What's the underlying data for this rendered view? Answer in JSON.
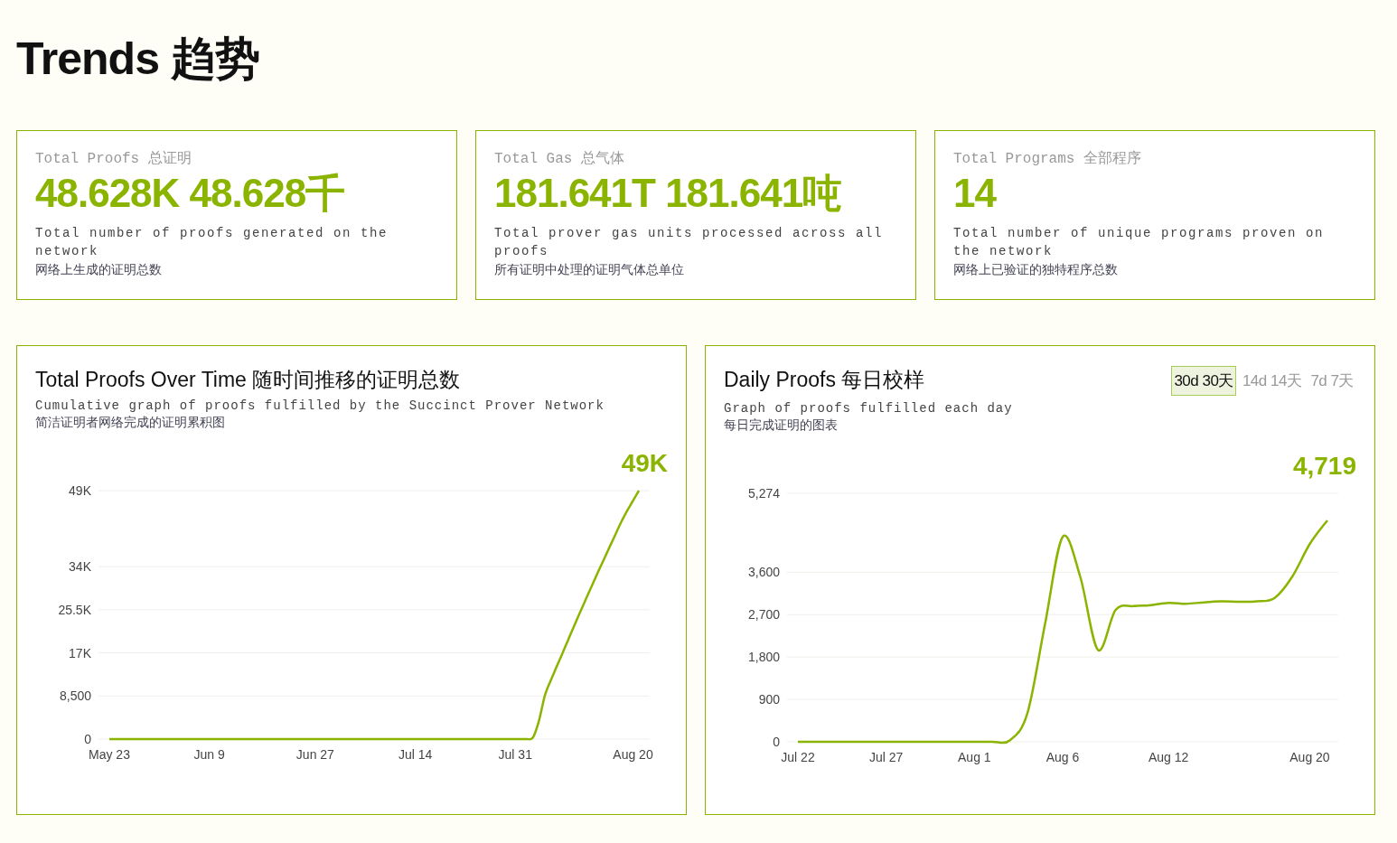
{
  "page_title": "Trends 趋势",
  "stats": [
    {
      "label": "Total Proofs 总证明",
      "value": "48.628K 48.628千",
      "description": "Total number of proofs generated on the network",
      "description_zh": "网络上生成的证明总数"
    },
    {
      "label": "Total Gas 总气体",
      "value": "181.641T 181.641吨",
      "description": "Total prover gas units processed across all proofs",
      "description_zh": "所有证明中处理的证明气体总单位"
    },
    {
      "label": "Total Programs 全部程序",
      "value": "14",
      "description": "Total number of unique programs proven on the network",
      "description_zh": "网络上已验证的独特程序总数"
    }
  ],
  "charts": [
    {
      "title": "Total Proofs Over Time  随时间推移的证明总数",
      "subtitle": "Cumulative graph of proofs fulfilled by the Succinct Prover Network",
      "subtitle_zh": "简洁证明者网络完成的证明累积图",
      "headline": "49K",
      "chart_data": {
        "type": "line",
        "grid": true,
        "categories": [
          "May 23",
          null,
          null,
          null,
          null,
          null,
          null,
          null,
          null,
          null,
          null,
          null,
          null,
          null,
          null,
          null,
          null,
          "Jun 9",
          null,
          null,
          null,
          null,
          null,
          null,
          null,
          null,
          null,
          null,
          null,
          null,
          null,
          null,
          null,
          null,
          null,
          "Jun 27",
          null,
          null,
          null,
          null,
          null,
          null,
          null,
          null,
          null,
          null,
          null,
          null,
          null,
          null,
          null,
          null,
          "Jul 14",
          null,
          null,
          null,
          null,
          null,
          null,
          null,
          null,
          null,
          null,
          null,
          null,
          null,
          null,
          null,
          null,
          "Jul 31",
          null,
          null,
          null,
          null,
          null,
          null,
          null,
          null,
          null,
          null,
          null,
          null,
          null,
          null,
          null,
          null,
          null,
          null,
          null,
          "Aug 20",
          null
        ],
        "series": [
          {
            "color": "#8ab400",
            "values": [
              0,
              0,
              0,
              0,
              0,
              0,
              0,
              0,
              0,
              0,
              0,
              0,
              0,
              0,
              0,
              0,
              0,
              0,
              0,
              0,
              0,
              0,
              0,
              0,
              0,
              0,
              0,
              0,
              0,
              0,
              0,
              0,
              0,
              0,
              0,
              0,
              0,
              0,
              0,
              0,
              0,
              0,
              0,
              0,
              0,
              0,
              0,
              0,
              0,
              0,
              0,
              0,
              0,
              0,
              0,
              0,
              0,
              0,
              0,
              0,
              0,
              0,
              0,
              0,
              0,
              0,
              0,
              0,
              0,
              0,
              0,
              0,
              300,
              3500,
              8500,
              11500,
              14200,
              16900,
              19600,
              22300,
              25000,
              27600,
              30200,
              32800,
              35300,
              37800,
              40300,
              42800,
              45000,
              47000,
              49000
            ]
          }
        ],
        "ylim": [
          0,
          49000
        ],
        "yticks": [
          0,
          {
            "value": 8500,
            "label": "8,500"
          },
          {
            "value": 17000,
            "label": "17K"
          },
          {
            "value": 25500,
            "label": "25.5K"
          },
          {
            "value": 34000,
            "label": "34K"
          },
          {
            "value": 49000,
            "label": "49K"
          }
        ]
      }
    },
    {
      "title": "Daily Proofs  每日校样",
      "subtitle": "Graph of proofs fulfilled each day",
      "subtitle_zh": "每日完成证明的图表",
      "headline": "4,719",
      "tabs": [
        {
          "label": "30d 30天",
          "selected": true
        },
        {
          "label": "14d 14天",
          "selected": false
        },
        {
          "label": "7d 7天",
          "selected": false
        }
      ],
      "chart_data": {
        "type": "line",
        "grid": true,
        "categories": [
          "Jul 22",
          null,
          null,
          null,
          null,
          "Jul 27",
          null,
          null,
          null,
          null,
          "Aug 1",
          null,
          null,
          null,
          null,
          "Aug 6",
          null,
          null,
          null,
          null,
          null,
          "Aug 12",
          null,
          null,
          null,
          null,
          null,
          null,
          null,
          "Aug 20",
          null
        ],
        "series": [
          {
            "color": "#8ab400",
            "values": [
              0,
              0,
              0,
              0,
              0,
              0,
              0,
              0,
              0,
              0,
              0,
              0,
              30,
              600,
              2500,
              4350,
              3500,
              1950,
              2800,
              2880,
              2900,
              2950,
              2930,
              2960,
              2980,
              2970,
              2980,
              3050,
              3500,
              4200,
              4700
            ]
          }
        ],
        "ylim": [
          0,
          5274
        ],
        "yticks": [
          0,
          {
            "value": 900,
            "label": "900"
          },
          {
            "value": 1800,
            "label": "1,800"
          },
          {
            "value": 2700,
            "label": "2,700"
          },
          {
            "value": 3600,
            "label": "3,600"
          },
          {
            "value": 5274,
            "label": "5,274"
          }
        ]
      }
    }
  ]
}
